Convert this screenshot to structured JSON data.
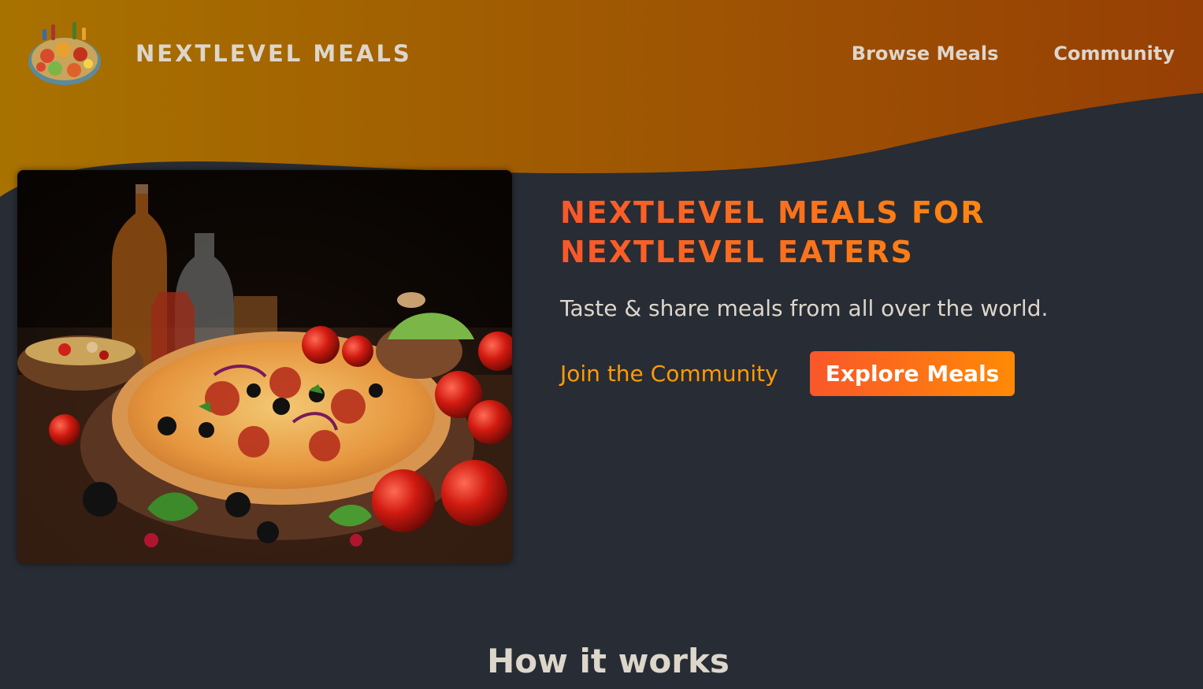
{
  "header": {
    "logo_alt": "A plate with food on it",
    "brand": "NEXTLEVEL MEALS",
    "nav": [
      {
        "label": "Browse Meals"
      },
      {
        "label": "Community"
      }
    ]
  },
  "hero": {
    "image_alt": "pizza",
    "title_line1": "NEXTLEVEL MEALS FOR",
    "title_line2": "NEXTLEVEL EATERS",
    "subtitle": "Taste & share meals from all over the world.",
    "community_link": "Join the Community",
    "explore_button": "Explore Meals"
  },
  "sections": {
    "how_it_works": "How it works"
  },
  "colors": {
    "background": "#282c34",
    "header_gradient_start": "#a87200",
    "header_gradient_end": "#973f05",
    "accent_start": "#f9572a",
    "accent_end": "#ff9b05",
    "text": "#ddd6cb"
  }
}
